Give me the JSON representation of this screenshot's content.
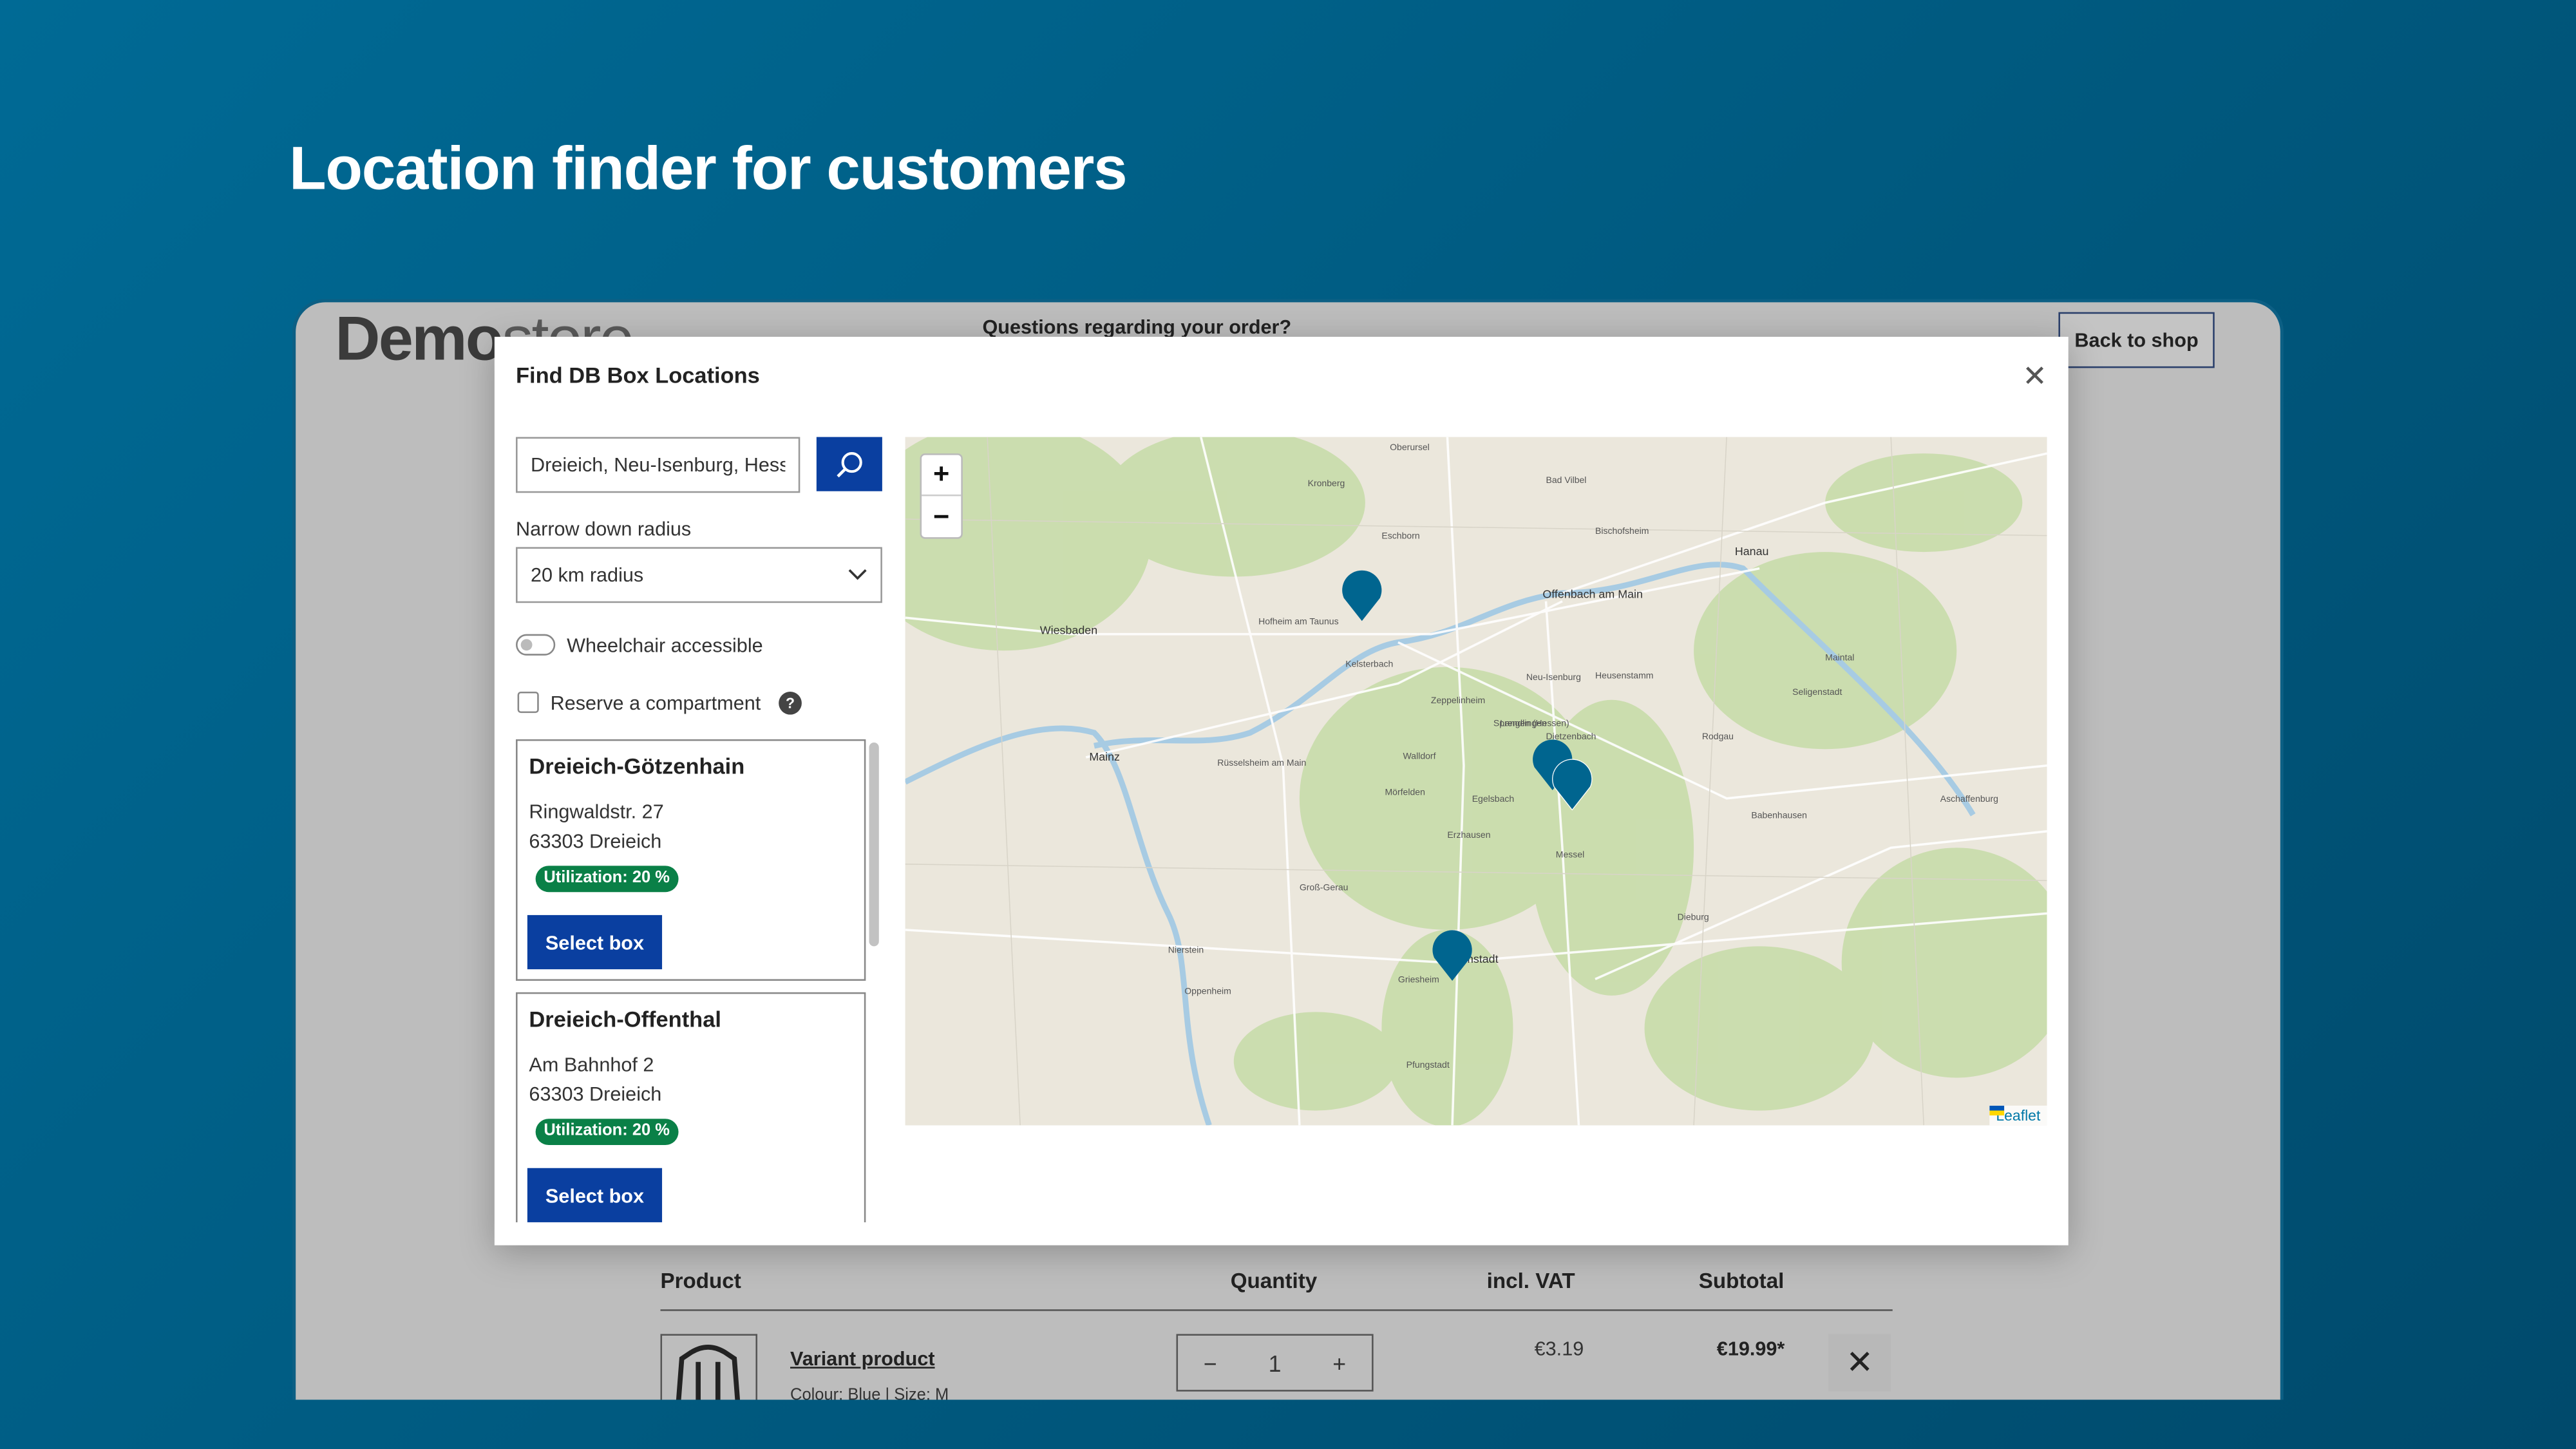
{
  "headline": "Location finder for customers",
  "store": {
    "logo_bold": "Demo",
    "logo_light": "store",
    "questions": "Questions regarding your order?",
    "back_to_shop": "Back to shop",
    "table": {
      "headers": [
        "Product",
        "Quantity",
        "incl. VAT",
        "Subtotal"
      ],
      "row": {
        "name": "Variant product",
        "meta": "Colour: Blue | Size: M",
        "quantity": "1",
        "vat": "€3.19",
        "subtotal": "€19.99*"
      }
    }
  },
  "modal": {
    "title": "Find DB Box Locations",
    "search_value": "Dreieich, Neu-Isenburg, Hessen",
    "radius_label": "Narrow down radius",
    "radius_value": "20 km radius",
    "wheelchair_label": "Wheelchair accessible",
    "wheelchair_on": false,
    "reserve_label": "Reserve a compartment",
    "reserve_checked": false,
    "select_label": "Select box",
    "locations": [
      {
        "name": "Dreieich-Götzenhain",
        "street": "Ringwaldstr. 27",
        "city": "63303 Dreieich",
        "utilization": "Utilization: 20 %"
      },
      {
        "name": "Dreieich-Offenthal",
        "street": "Am Bahnhof 2",
        "city": "63303 Dreieich",
        "utilization": "Utilization: 20 %"
      }
    ]
  },
  "map": {
    "attribution": "Leaflet",
    "zoom_in": "+",
    "zoom_out": "−",
    "labels": [
      "Wiesbaden",
      "Mainz",
      "Offenbach am Main",
      "Hanau",
      "Neu-Isenburg",
      "Langen (Hessen)",
      "Sprendlingen",
      "Dietzenbach",
      "Rodgau",
      "Mörfelden",
      "Walldorf",
      "Kelsterbach",
      "Rüsselsheim am Main",
      "Eschborn",
      "Bad Vilbel",
      "Oberursel",
      "Kronberg",
      "Hofheim am Taunus",
      "Egelsbach",
      "Messel",
      "Dieburg",
      "Groß-Gerau",
      "Griesheim",
      "mstadt",
      "Seligenstadt",
      "Babenhausen",
      "Aschaffenburg",
      "Heusenstamm",
      "Nierstein",
      "Oppenheim",
      "Pfungstadt",
      "Zeppelinheim",
      "Erzhausen",
      "Bischofsheim",
      "Maintal"
    ],
    "colors": {
      "marker": "#00658f",
      "forest": "#c8dcaa",
      "water": "#a7cbe3"
    }
  },
  "colors": {
    "primary_button": "#0a3fa0",
    "badge": "#0a8047",
    "background": "#005a80"
  }
}
